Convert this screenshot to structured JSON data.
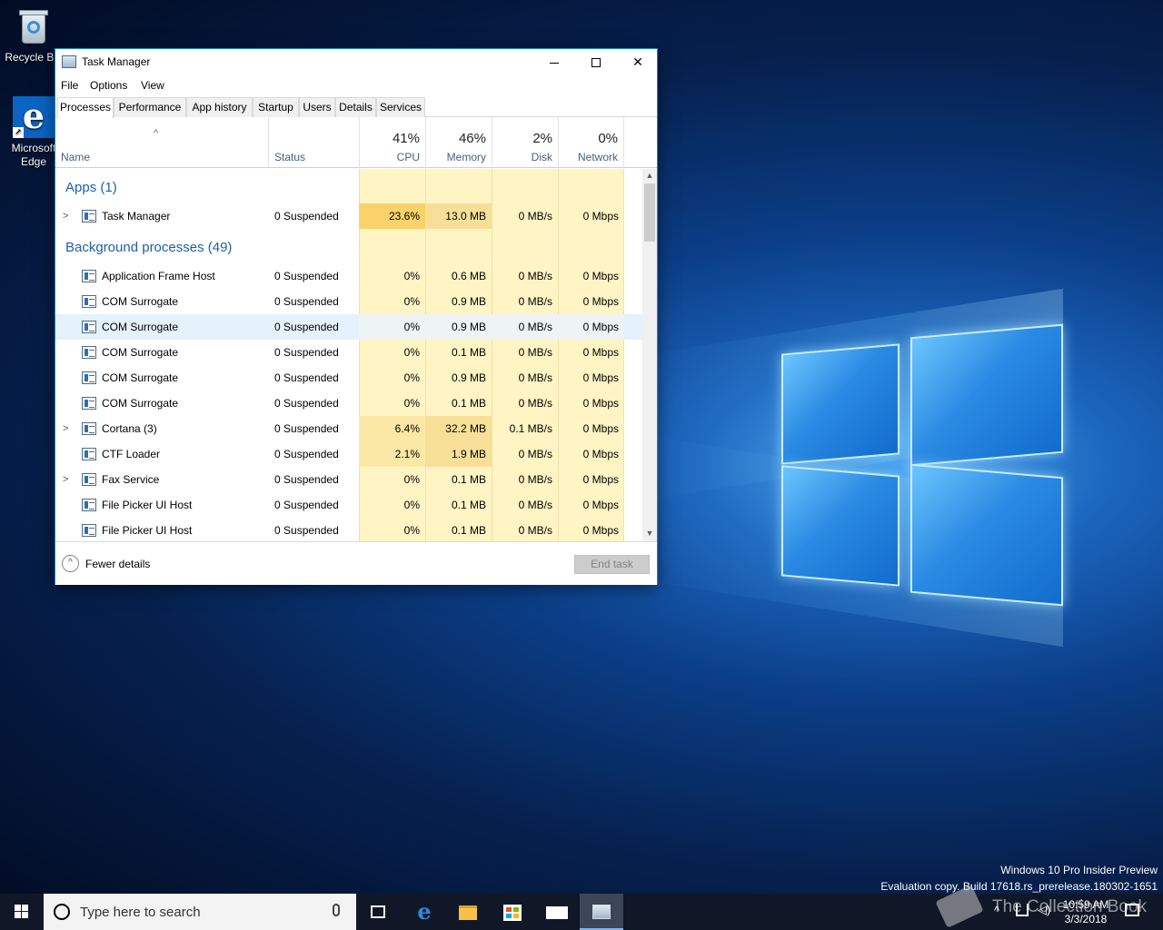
{
  "desktop": {
    "icons": [
      {
        "label": "Recycle Bin"
      },
      {
        "label": "Microsoft Edge"
      }
    ],
    "watermark": {
      "line1": "Windows 10 Pro Insider Preview",
      "line2": "Evaluation copy. Build 17618.rs_prerelease.180302-1651",
      "overlay_text": "The Collection Book"
    }
  },
  "window": {
    "title": "Task Manager",
    "controls": {
      "minimize": "—",
      "maximize": "",
      "close": "✕"
    }
  },
  "menu": [
    "File",
    "Options",
    "View"
  ],
  "tabs": [
    "Processes",
    "Performance",
    "App history",
    "Startup",
    "Users",
    "Details",
    "Services"
  ],
  "active_tab": "Processes",
  "header": {
    "name": "Name",
    "status": "Status",
    "cpu": {
      "pct": "41%",
      "label": "CPU"
    },
    "memory": {
      "pct": "46%",
      "label": "Memory"
    },
    "disk": {
      "pct": "2%",
      "label": "Disk"
    },
    "network": {
      "pct": "0%",
      "label": "Network"
    }
  },
  "groups": {
    "apps": "Apps (1)",
    "background": "Background processes (49)"
  },
  "processes": [
    {
      "name": "Task Manager",
      "status": "Suspended",
      "cpu": "23.6%",
      "memory": "13.0 MB",
      "disk": "0 MB/s",
      "network": "0 Mbps",
      "expandable": true
    },
    {
      "name": "Application Frame Host",
      "status": "Suspended",
      "cpu": "0%",
      "memory": "0.6 MB",
      "disk": "0 MB/s",
      "network": "0 Mbps"
    },
    {
      "name": "COM Surrogate",
      "status": "Suspended",
      "cpu": "0%",
      "memory": "0.9 MB",
      "disk": "0 MB/s",
      "network": "0 Mbps"
    },
    {
      "name": "COM Surrogate",
      "status": "Suspended",
      "cpu": "0%",
      "memory": "0.9 MB",
      "disk": "0 MB/s",
      "network": "0 Mbps",
      "selected": true
    },
    {
      "name": "COM Surrogate",
      "status": "Suspended",
      "cpu": "0%",
      "memory": "0.1 MB",
      "disk": "0 MB/s",
      "network": "0 Mbps"
    },
    {
      "name": "COM Surrogate",
      "status": "Suspended",
      "cpu": "0%",
      "memory": "0.9 MB",
      "disk": "0 MB/s",
      "network": "0 Mbps"
    },
    {
      "name": "COM Surrogate",
      "status": "Suspended",
      "cpu": "0%",
      "memory": "0.1 MB",
      "disk": "0 MB/s",
      "network": "0 Mbps"
    },
    {
      "name": "Cortana (3)",
      "status": "Suspended",
      "cpu": "6.4%",
      "memory": "32.2 MB",
      "disk": "0.1 MB/s",
      "network": "0 Mbps",
      "expandable": true
    },
    {
      "name": "CTF Loader",
      "status": "Suspended",
      "cpu": "2.1%",
      "memory": "1.9 MB",
      "disk": "0 MB/s",
      "network": "0 Mbps"
    },
    {
      "name": "Fax Service",
      "status": "Suspended",
      "cpu": "0%",
      "memory": "0.1 MB",
      "disk": "0 MB/s",
      "network": "0 Mbps",
      "expandable": true
    },
    {
      "name": "File Picker UI Host",
      "status": "Suspended",
      "cpu": "0%",
      "memory": "0.1 MB",
      "disk": "0 MB/s",
      "network": "0 Mbps"
    },
    {
      "name": "File Picker UI Host",
      "status": "Suspended",
      "cpu": "0%",
      "memory": "0.1 MB",
      "disk": "0 MB/s",
      "network": "0 Mbps"
    }
  ],
  "footer": {
    "fewer_details": "Fewer details",
    "end_task": "End task"
  },
  "taskbar": {
    "search_placeholder": "Type here to search",
    "time": "10:59 AM",
    "date": "3/3/2018"
  },
  "colors": {
    "accent": "#1883d7",
    "cpu_hot": "#f9d26b",
    "col_bg": "#fff4c4",
    "group_title": "#1e5fa8"
  }
}
